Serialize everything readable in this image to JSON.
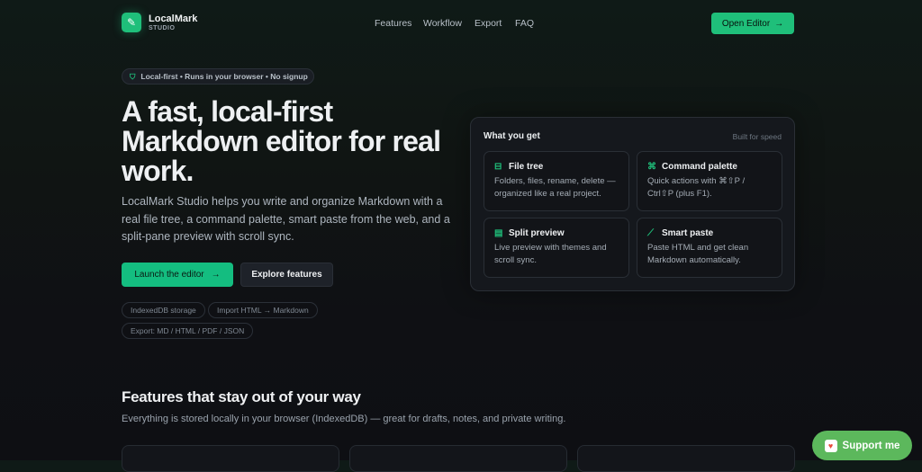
{
  "header": {
    "brand": "LocalMark",
    "brand_sub": "STUDIO",
    "nav": [
      "Features",
      "Workflow",
      "Export",
      "FAQ"
    ],
    "open_editor": "Open Editor"
  },
  "hero": {
    "badge": "Local-first • Runs in your browser • No signup",
    "title": "A fast, local-first Markdown editor for real work.",
    "lead": "LocalMark Studio helps you write and organize Markdown with a real file tree, a command palette, smart paste from the web, and a split-pane preview with scroll sync.",
    "launch": "Launch the editor",
    "explore": "Explore features",
    "chips": [
      "IndexedDB storage",
      "Import HTML → Markdown",
      "Export: MD / HTML / PDF / JSON"
    ]
  },
  "panel": {
    "title": "What you get",
    "side": "Built for speed",
    "cards": [
      {
        "title": "File tree",
        "desc": "Folders, files, rename, delete — organized like a real project.",
        "icon": "file-tree-icon"
      },
      {
        "title": "Command palette",
        "desc": "Quick actions with ⌘⇧P / Ctrl⇧P (plus F1).",
        "icon": "command-icon"
      },
      {
        "title": "Split preview",
        "desc": "Live preview with themes and scroll sync.",
        "icon": "split-icon"
      },
      {
        "title": "Smart paste",
        "desc": "Paste HTML and get clean Markdown automatically.",
        "icon": "wand-icon"
      }
    ]
  },
  "features": {
    "title": "Features that stay out of your way",
    "subtitle": "Everything is stored locally in your browser (IndexedDB) — great for drafts, notes, and private writing."
  },
  "support": {
    "label": "Support me"
  },
  "colors": {
    "accent": "#1fbf7a",
    "support": "#5cb85c"
  }
}
